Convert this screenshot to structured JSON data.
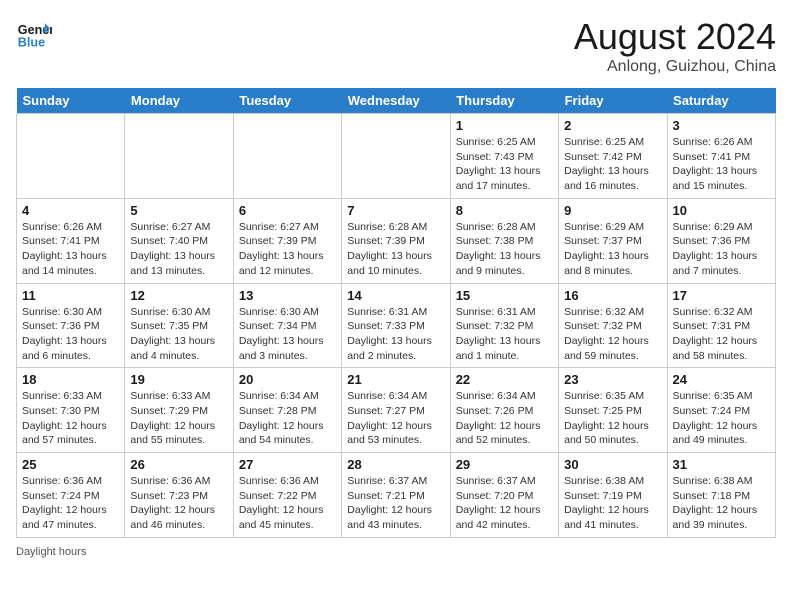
{
  "header": {
    "logo_line1": "General",
    "logo_line2": "Blue",
    "month_title": "August 2024",
    "location": "Anlong, Guizhou, China"
  },
  "days_of_week": [
    "Sunday",
    "Monday",
    "Tuesday",
    "Wednesday",
    "Thursday",
    "Friday",
    "Saturday"
  ],
  "weeks": [
    [
      {
        "day": "",
        "info": ""
      },
      {
        "day": "",
        "info": ""
      },
      {
        "day": "",
        "info": ""
      },
      {
        "day": "",
        "info": ""
      },
      {
        "day": "1",
        "info": "Sunrise: 6:25 AM\nSunset: 7:43 PM\nDaylight: 13 hours\nand 17 minutes."
      },
      {
        "day": "2",
        "info": "Sunrise: 6:25 AM\nSunset: 7:42 PM\nDaylight: 13 hours\nand 16 minutes."
      },
      {
        "day": "3",
        "info": "Sunrise: 6:26 AM\nSunset: 7:41 PM\nDaylight: 13 hours\nand 15 minutes."
      }
    ],
    [
      {
        "day": "4",
        "info": "Sunrise: 6:26 AM\nSunset: 7:41 PM\nDaylight: 13 hours\nand 14 minutes."
      },
      {
        "day": "5",
        "info": "Sunrise: 6:27 AM\nSunset: 7:40 PM\nDaylight: 13 hours\nand 13 minutes."
      },
      {
        "day": "6",
        "info": "Sunrise: 6:27 AM\nSunset: 7:39 PM\nDaylight: 13 hours\nand 12 minutes."
      },
      {
        "day": "7",
        "info": "Sunrise: 6:28 AM\nSunset: 7:39 PM\nDaylight: 13 hours\nand 10 minutes."
      },
      {
        "day": "8",
        "info": "Sunrise: 6:28 AM\nSunset: 7:38 PM\nDaylight: 13 hours\nand 9 minutes."
      },
      {
        "day": "9",
        "info": "Sunrise: 6:29 AM\nSunset: 7:37 PM\nDaylight: 13 hours\nand 8 minutes."
      },
      {
        "day": "10",
        "info": "Sunrise: 6:29 AM\nSunset: 7:36 PM\nDaylight: 13 hours\nand 7 minutes."
      }
    ],
    [
      {
        "day": "11",
        "info": "Sunrise: 6:30 AM\nSunset: 7:36 PM\nDaylight: 13 hours\nand 6 minutes."
      },
      {
        "day": "12",
        "info": "Sunrise: 6:30 AM\nSunset: 7:35 PM\nDaylight: 13 hours\nand 4 minutes."
      },
      {
        "day": "13",
        "info": "Sunrise: 6:30 AM\nSunset: 7:34 PM\nDaylight: 13 hours\nand 3 minutes."
      },
      {
        "day": "14",
        "info": "Sunrise: 6:31 AM\nSunset: 7:33 PM\nDaylight: 13 hours\nand 2 minutes."
      },
      {
        "day": "15",
        "info": "Sunrise: 6:31 AM\nSunset: 7:32 PM\nDaylight: 13 hours\nand 1 minute."
      },
      {
        "day": "16",
        "info": "Sunrise: 6:32 AM\nSunset: 7:32 PM\nDaylight: 12 hours\nand 59 minutes."
      },
      {
        "day": "17",
        "info": "Sunrise: 6:32 AM\nSunset: 7:31 PM\nDaylight: 12 hours\nand 58 minutes."
      }
    ],
    [
      {
        "day": "18",
        "info": "Sunrise: 6:33 AM\nSunset: 7:30 PM\nDaylight: 12 hours\nand 57 minutes."
      },
      {
        "day": "19",
        "info": "Sunrise: 6:33 AM\nSunset: 7:29 PM\nDaylight: 12 hours\nand 55 minutes."
      },
      {
        "day": "20",
        "info": "Sunrise: 6:34 AM\nSunset: 7:28 PM\nDaylight: 12 hours\nand 54 minutes."
      },
      {
        "day": "21",
        "info": "Sunrise: 6:34 AM\nSunset: 7:27 PM\nDaylight: 12 hours\nand 53 minutes."
      },
      {
        "day": "22",
        "info": "Sunrise: 6:34 AM\nSunset: 7:26 PM\nDaylight: 12 hours\nand 52 minutes."
      },
      {
        "day": "23",
        "info": "Sunrise: 6:35 AM\nSunset: 7:25 PM\nDaylight: 12 hours\nand 50 minutes."
      },
      {
        "day": "24",
        "info": "Sunrise: 6:35 AM\nSunset: 7:24 PM\nDaylight: 12 hours\nand 49 minutes."
      }
    ],
    [
      {
        "day": "25",
        "info": "Sunrise: 6:36 AM\nSunset: 7:24 PM\nDaylight: 12 hours\nand 47 minutes."
      },
      {
        "day": "26",
        "info": "Sunrise: 6:36 AM\nSunset: 7:23 PM\nDaylight: 12 hours\nand 46 minutes."
      },
      {
        "day": "27",
        "info": "Sunrise: 6:36 AM\nSunset: 7:22 PM\nDaylight: 12 hours\nand 45 minutes."
      },
      {
        "day": "28",
        "info": "Sunrise: 6:37 AM\nSunset: 7:21 PM\nDaylight: 12 hours\nand 43 minutes."
      },
      {
        "day": "29",
        "info": "Sunrise: 6:37 AM\nSunset: 7:20 PM\nDaylight: 12 hours\nand 42 minutes."
      },
      {
        "day": "30",
        "info": "Sunrise: 6:38 AM\nSunset: 7:19 PM\nDaylight: 12 hours\nand 41 minutes."
      },
      {
        "day": "31",
        "info": "Sunrise: 6:38 AM\nSunset: 7:18 PM\nDaylight: 12 hours\nand 39 minutes."
      }
    ]
  ],
  "legend": {
    "daylight_label": "Daylight hours"
  }
}
